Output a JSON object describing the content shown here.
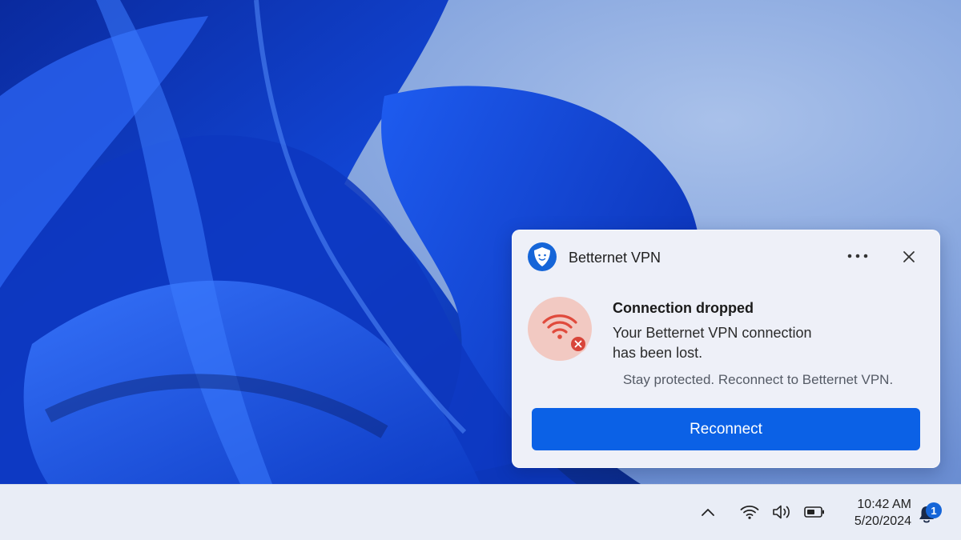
{
  "toast": {
    "app_name": "Betternet VPN",
    "app_icon": "betternet-shield-icon",
    "more_icon": "more-options-icon",
    "close_icon": "close-icon",
    "status_icon": "wifi-disconnected-icon",
    "title": "Connection dropped",
    "body_line1": "Your Betternet VPN connection",
    "body_line2": "has been lost.",
    "hint": "Stay protected. Reconnect to Betternet VPN.",
    "action_label": "Reconnect"
  },
  "taskbar": {
    "tray_icons": [
      "chevron-up-icon",
      "wifi-icon",
      "volume-icon",
      "battery-icon"
    ],
    "time": "10:42 AM",
    "date": "5/20/2024",
    "notification_count": "1",
    "notification_icon": "bell-icon"
  },
  "colors": {
    "accent": "#0b61e6",
    "error": "#d8453a",
    "error_bg": "#f2c9c2",
    "toast_bg": "#eef0f8",
    "taskbar_bg": "#e9edf6"
  }
}
